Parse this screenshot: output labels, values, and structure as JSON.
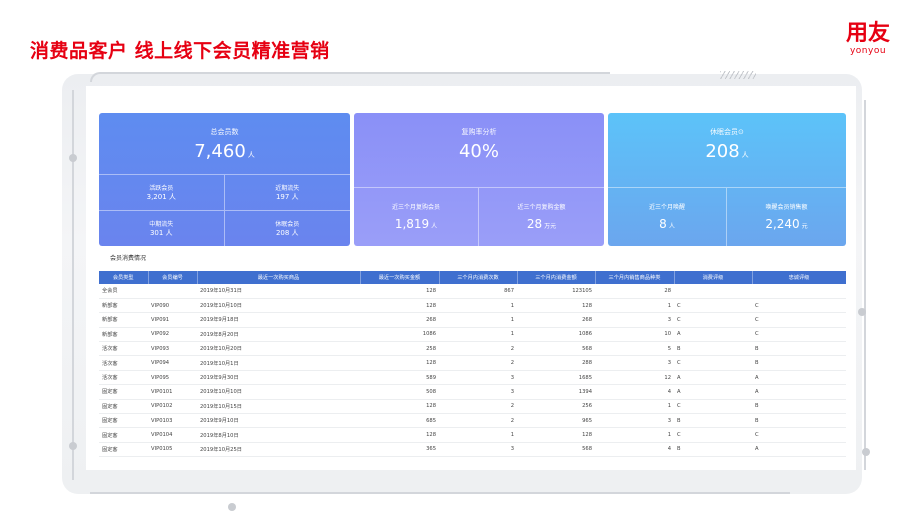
{
  "slide": {
    "title": "消费品客户 线上线下会员精准营销",
    "logo_main": "用友",
    "logo_sub": "yonyou"
  },
  "cards": [
    {
      "label": "总会员数",
      "value": "7,460",
      "unit": "人",
      "sub": [
        {
          "label": "活跃会员",
          "value": "3,201 人"
        },
        {
          "label": "近期流失",
          "value": "197 人"
        },
        {
          "label": "中期流失",
          "value": "301 人"
        },
        {
          "label": "休眠会员",
          "value": "208 人"
        }
      ]
    },
    {
      "label": "复购率分析",
      "value": "40%",
      "unit": "",
      "sub": [
        {
          "label": "近三个月复购会员",
          "value": "1,819",
          "unit": "人"
        },
        {
          "label": "近三个月复购金额",
          "value": "28",
          "unit": "万元"
        }
      ]
    },
    {
      "label": "休眠会员⊙",
      "value": "208",
      "unit": "人",
      "sub": [
        {
          "label": "近三个月唤醒",
          "value": "8",
          "unit": "人"
        },
        {
          "label": "唤醒会员销售额",
          "value": "2,240",
          "unit": "元"
        }
      ]
    }
  ],
  "section_title": "会员消费情况",
  "table": {
    "headers": [
      "会员类型",
      "会员编号",
      "最近一次购买商品",
      "最近一次购买金额",
      "三个月内消费次数",
      "三个月内消费金额",
      "三个月内销售商品种类",
      "消费评级",
      "忠诚评级"
    ],
    "rows": [
      [
        "全会员",
        "",
        "2019年10月31日",
        "128",
        "867",
        "123105",
        "28",
        "",
        ""
      ],
      [
        "新部客",
        "VIP090",
        "2019年10月10日",
        "128",
        "1",
        "128",
        "1",
        "C",
        "C"
      ],
      [
        "新部客",
        "VIP091",
        "2019年9月18日",
        "268",
        "1",
        "268",
        "3",
        "C",
        "C"
      ],
      [
        "新部客",
        "VIP092",
        "2019年8月20日",
        "1086",
        "1",
        "1086",
        "10",
        "A",
        "C"
      ],
      [
        "活次客",
        "VIP093",
        "2019年10月20日",
        "258",
        "2",
        "568",
        "5",
        "B",
        "B"
      ],
      [
        "活次客",
        "VIP094",
        "2019年10月1日",
        "128",
        "2",
        "288",
        "3",
        "C",
        "B"
      ],
      [
        "活次客",
        "VIP095",
        "2019年9月30日",
        "589",
        "3",
        "1685",
        "12",
        "A",
        "A"
      ],
      [
        "固定客",
        "VIP0101",
        "2019年10月10日",
        "508",
        "3",
        "1394",
        "4",
        "A",
        "A"
      ],
      [
        "固定客",
        "VIP0102",
        "2019年10月15日",
        "128",
        "2",
        "256",
        "1",
        "C",
        "B"
      ],
      [
        "固定客",
        "VIP0103",
        "2019年9月10日",
        "685",
        "2",
        "965",
        "3",
        "B",
        "B"
      ],
      [
        "固定客",
        "VIP0104",
        "2019年8月10日",
        "128",
        "1",
        "128",
        "1",
        "C",
        "C"
      ],
      [
        "固定客",
        "VIP0105",
        "2019年10月25日",
        "365",
        "3",
        "568",
        "4",
        "B",
        "A"
      ]
    ]
  }
}
